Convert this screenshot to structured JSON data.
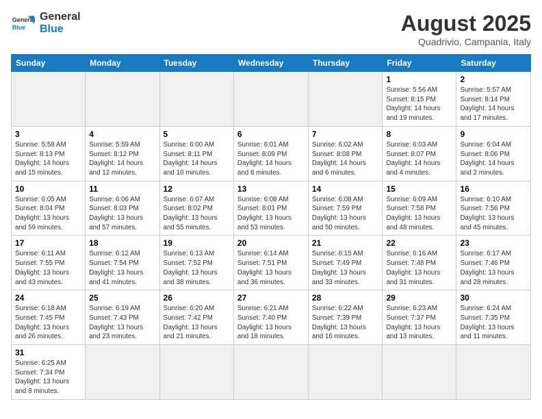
{
  "header": {
    "logo_general": "General",
    "logo_blue": "Blue",
    "month_title": "August 2025",
    "location": "Quadrivio, Campania, Italy"
  },
  "days_of_week": [
    "Sunday",
    "Monday",
    "Tuesday",
    "Wednesday",
    "Thursday",
    "Friday",
    "Saturday"
  ],
  "weeks": [
    [
      {
        "num": "",
        "info": ""
      },
      {
        "num": "",
        "info": ""
      },
      {
        "num": "",
        "info": ""
      },
      {
        "num": "",
        "info": ""
      },
      {
        "num": "",
        "info": ""
      },
      {
        "num": "1",
        "info": "Sunrise: 5:56 AM\nSunset: 8:15 PM\nDaylight: 14 hours and 19 minutes."
      },
      {
        "num": "2",
        "info": "Sunrise: 5:57 AM\nSunset: 8:14 PM\nDaylight: 14 hours and 17 minutes."
      }
    ],
    [
      {
        "num": "3",
        "info": "Sunrise: 5:58 AM\nSunset: 8:13 PM\nDaylight: 14 hours and 15 minutes."
      },
      {
        "num": "4",
        "info": "Sunrise: 5:59 AM\nSunset: 8:12 PM\nDaylight: 14 hours and 12 minutes."
      },
      {
        "num": "5",
        "info": "Sunrise: 6:00 AM\nSunset: 8:11 PM\nDaylight: 14 hours and 10 minutes."
      },
      {
        "num": "6",
        "info": "Sunrise: 6:01 AM\nSunset: 8:09 PM\nDaylight: 14 hours and 8 minutes."
      },
      {
        "num": "7",
        "info": "Sunrise: 6:02 AM\nSunset: 8:08 PM\nDaylight: 14 hours and 6 minutes."
      },
      {
        "num": "8",
        "info": "Sunrise: 6:03 AM\nSunset: 8:07 PM\nDaylight: 14 hours and 4 minutes."
      },
      {
        "num": "9",
        "info": "Sunrise: 6:04 AM\nSunset: 8:06 PM\nDaylight: 14 hours and 2 minutes."
      }
    ],
    [
      {
        "num": "10",
        "info": "Sunrise: 6:05 AM\nSunset: 8:04 PM\nDaylight: 13 hours and 59 minutes."
      },
      {
        "num": "11",
        "info": "Sunrise: 6:06 AM\nSunset: 8:03 PM\nDaylight: 13 hours and 57 minutes."
      },
      {
        "num": "12",
        "info": "Sunrise: 6:07 AM\nSunset: 8:02 PM\nDaylight: 13 hours and 55 minutes."
      },
      {
        "num": "13",
        "info": "Sunrise: 6:08 AM\nSunset: 8:01 PM\nDaylight: 13 hours and 53 minutes."
      },
      {
        "num": "14",
        "info": "Sunrise: 6:08 AM\nSunset: 7:59 PM\nDaylight: 13 hours and 50 minutes."
      },
      {
        "num": "15",
        "info": "Sunrise: 6:09 AM\nSunset: 7:58 PM\nDaylight: 13 hours and 48 minutes."
      },
      {
        "num": "16",
        "info": "Sunrise: 6:10 AM\nSunset: 7:56 PM\nDaylight: 13 hours and 45 minutes."
      }
    ],
    [
      {
        "num": "17",
        "info": "Sunrise: 6:11 AM\nSunset: 7:55 PM\nDaylight: 13 hours and 43 minutes."
      },
      {
        "num": "18",
        "info": "Sunrise: 6:12 AM\nSunset: 7:54 PM\nDaylight: 13 hours and 41 minutes."
      },
      {
        "num": "19",
        "info": "Sunrise: 6:13 AM\nSunset: 7:52 PM\nDaylight: 13 hours and 38 minutes."
      },
      {
        "num": "20",
        "info": "Sunrise: 6:14 AM\nSunset: 7:51 PM\nDaylight: 13 hours and 36 minutes."
      },
      {
        "num": "21",
        "info": "Sunrise: 6:15 AM\nSunset: 7:49 PM\nDaylight: 13 hours and 33 minutes."
      },
      {
        "num": "22",
        "info": "Sunrise: 6:16 AM\nSunset: 7:48 PM\nDaylight: 13 hours and 31 minutes."
      },
      {
        "num": "23",
        "info": "Sunrise: 6:17 AM\nSunset: 7:46 PM\nDaylight: 13 hours and 28 minutes."
      }
    ],
    [
      {
        "num": "24",
        "info": "Sunrise: 6:18 AM\nSunset: 7:45 PM\nDaylight: 13 hours and 26 minutes."
      },
      {
        "num": "25",
        "info": "Sunrise: 6:19 AM\nSunset: 7:43 PM\nDaylight: 13 hours and 23 minutes."
      },
      {
        "num": "26",
        "info": "Sunrise: 6:20 AM\nSunset: 7:42 PM\nDaylight: 13 hours and 21 minutes."
      },
      {
        "num": "27",
        "info": "Sunrise: 6:21 AM\nSunset: 7:40 PM\nDaylight: 13 hours and 18 minutes."
      },
      {
        "num": "28",
        "info": "Sunrise: 6:22 AM\nSunset: 7:39 PM\nDaylight: 13 hours and 16 minutes."
      },
      {
        "num": "29",
        "info": "Sunrise: 6:23 AM\nSunset: 7:37 PM\nDaylight: 13 hours and 13 minutes."
      },
      {
        "num": "30",
        "info": "Sunrise: 6:24 AM\nSunset: 7:35 PM\nDaylight: 13 hours and 11 minutes."
      }
    ],
    [
      {
        "num": "31",
        "info": "Sunrise: 6:25 AM\nSunset: 7:34 PM\nDaylight: 13 hours and 8 minutes."
      },
      {
        "num": "",
        "info": ""
      },
      {
        "num": "",
        "info": ""
      },
      {
        "num": "",
        "info": ""
      },
      {
        "num": "",
        "info": ""
      },
      {
        "num": "",
        "info": ""
      },
      {
        "num": "",
        "info": ""
      }
    ]
  ]
}
